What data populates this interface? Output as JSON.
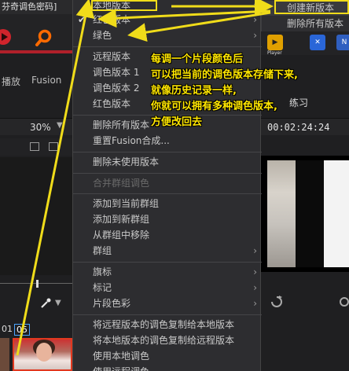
{
  "app": {
    "window_title": "芬奇调色密码]",
    "tabs": {
      "playback": "播放",
      "fusion": "Fusion"
    },
    "zoom_level": "30%",
    "timecode": "00:02:24:24",
    "right_label": "练习",
    "player_badge": "Player",
    "clip_numbers": [
      "01",
      "05"
    ]
  },
  "submenu": {
    "create_version": "创建新版本",
    "delete_all_versions": "删除所有版本"
  },
  "menu": {
    "local_version": "本地版本",
    "red_version_checked": "红色版本",
    "green": "绿色",
    "remote_version": "远程版本",
    "grade_version_1": "调色版本 1",
    "grade_version_2": "调色版本 2",
    "red_version": "红色版本",
    "delete_all_versions": "删除所有版本",
    "reset_fusion": "重置Fusion合成...",
    "delete_unused_versions": "删除未使用版本",
    "merge_group_grades": "合并群组调色",
    "add_to_current_group": "添加到当前群组",
    "add_to_new_group": "添加到新群组",
    "remove_from_group": "从群组中移除",
    "group": "群组",
    "flags": "旗标",
    "markers": "标记",
    "clip_color": "片段色彩",
    "copy_remote_to_local": "将远程版本的调色复制给本地版本",
    "copy_local_to_remote": "将本地版本的调色复制给远程版本",
    "use_local_grades": "使用本地调色",
    "use_remote_grades": "使用远程调色"
  },
  "annotation": {
    "lines": [
      "每调一个片段颜色后",
      "可以把当前的调色版本存储下来,",
      "就像历史记录一样,",
      "你就可以拥有多种调色版本,",
      "方便改回去"
    ],
    "color": "#ffe600"
  },
  "colors": {
    "menu_bg": "#2d2d30",
    "highlight": "#f0dc1a",
    "accent_red": "#b0202a"
  }
}
